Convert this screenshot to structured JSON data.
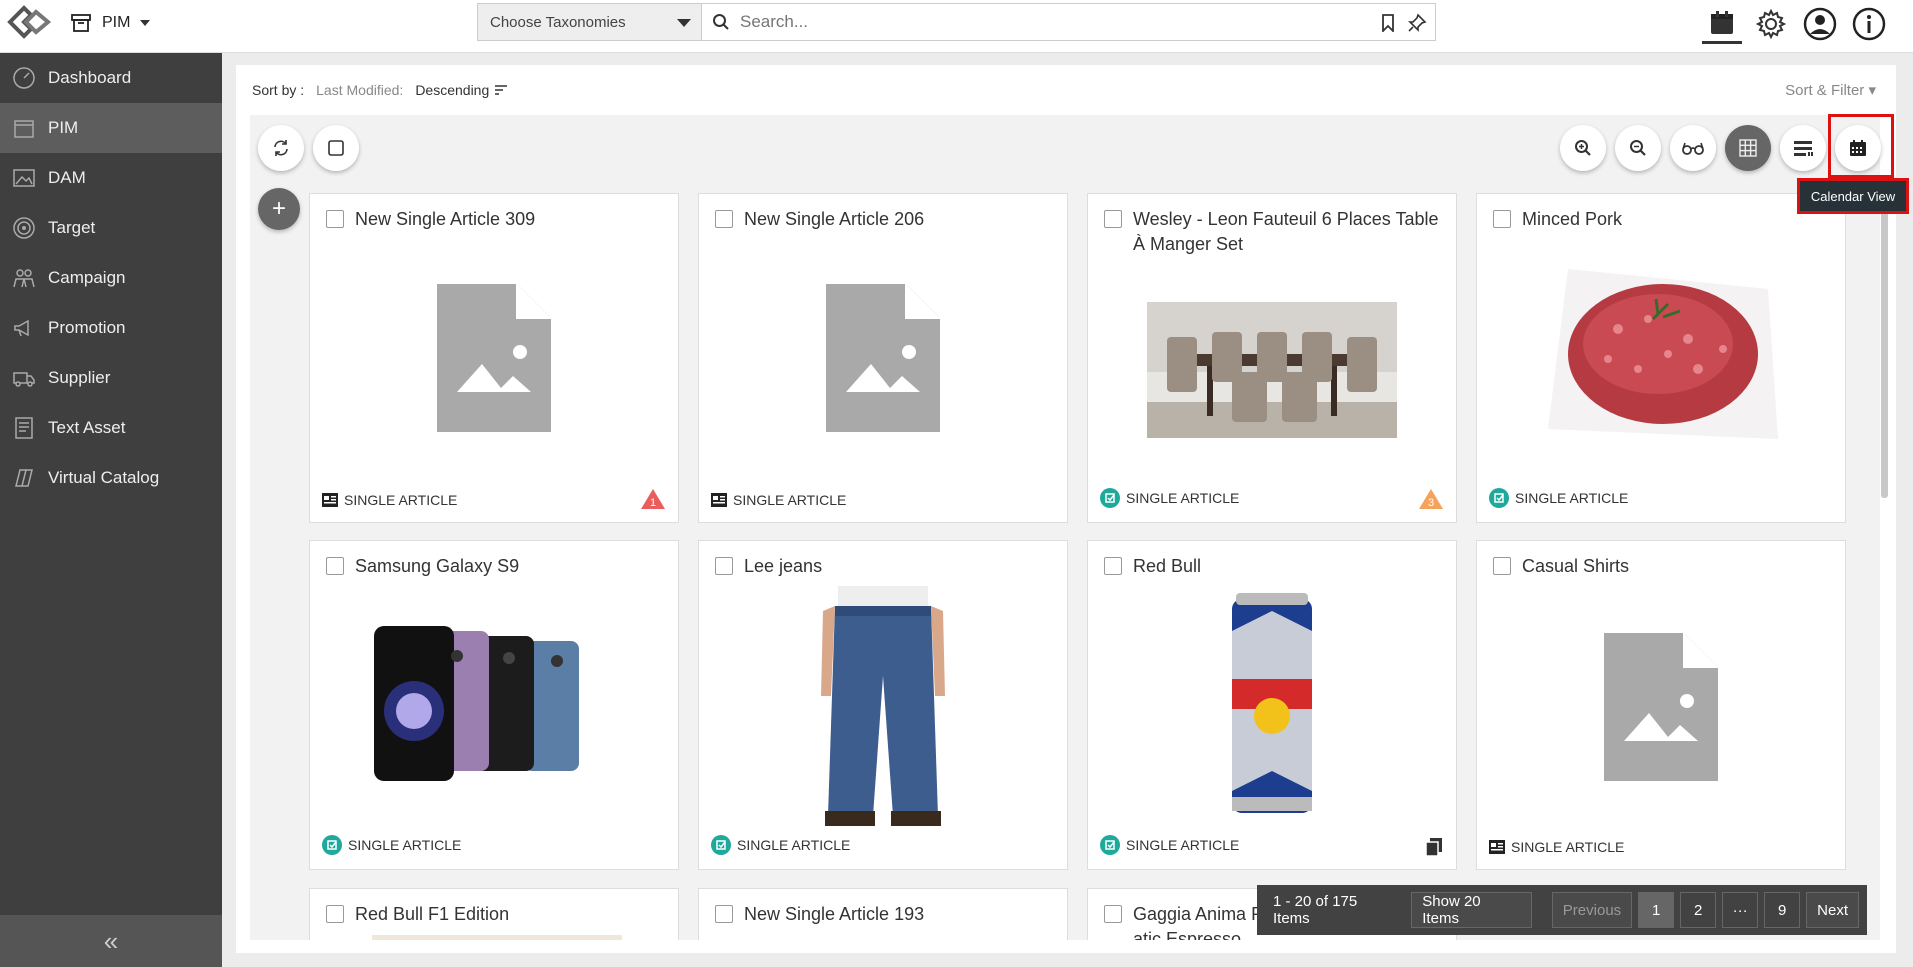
{
  "header": {
    "module": "PIM",
    "taxonomy_placeholder": "Choose Taxonomies",
    "search_placeholder": "Search..."
  },
  "sidebar": {
    "items": [
      {
        "label": "Dashboard",
        "icon": "dashboard-icon"
      },
      {
        "label": "PIM",
        "icon": "pim-icon"
      },
      {
        "label": "DAM",
        "icon": "image-icon"
      },
      {
        "label": "Target",
        "icon": "target-icon"
      },
      {
        "label": "Campaign",
        "icon": "campaign-icon"
      },
      {
        "label": "Promotion",
        "icon": "megaphone-icon"
      },
      {
        "label": "Supplier",
        "icon": "truck-icon"
      },
      {
        "label": "Text Asset",
        "icon": "text-asset-icon"
      },
      {
        "label": "Virtual Catalog",
        "icon": "catalog-icon"
      }
    ],
    "active": "PIM"
  },
  "sortbar": {
    "sort_by_label": "Sort by :",
    "last_modified_label": "Last Modified:",
    "direction": "Descending",
    "sort_filter": "Sort & Filter"
  },
  "tooltip": "Calendar View",
  "cards": [
    {
      "title": "New Single Article 309",
      "type": "SINGLE ARTICLE",
      "image": "placeholder",
      "badge": "1"
    },
    {
      "title": "New Single Article 206",
      "type": "SINGLE ARTICLE",
      "image": "placeholder",
      "badge": ""
    },
    {
      "title": "Wesley - Leon Fauteuil 6 Places Table À Manger Set",
      "type": "SINGLE ARTICLE",
      "image": "dining-table",
      "badge": "3"
    },
    {
      "title": "Minced Pork",
      "type": "SINGLE ARTICLE",
      "image": "minced-pork",
      "badge": ""
    },
    {
      "title": "Samsung Galaxy S9",
      "type": "SINGLE ARTICLE",
      "image": "phones",
      "badge": ""
    },
    {
      "title": "Lee jeans",
      "type": "SINGLE ARTICLE",
      "image": "jeans",
      "badge": ""
    },
    {
      "title": "Red Bull",
      "type": "SINGLE ARTICLE",
      "image": "can",
      "badge": ""
    },
    {
      "title": "Casual Shirts",
      "type": "SINGLE ARTICLE",
      "image": "placeholder",
      "badge": ""
    },
    {
      "title": "Red Bull F1 Edition",
      "type": "",
      "image": "",
      "badge": ""
    },
    {
      "title": "New Single Article 193",
      "type": "",
      "image": "",
      "badge": ""
    },
    {
      "title": "Gaggia Anima P…atic Espresso Machine",
      "type": "",
      "image": "",
      "badge": ""
    }
  ],
  "pagination": {
    "range": "1 - 20 of 175 Items",
    "show": "Show 20 Items",
    "previous": "Previous",
    "pages": [
      "1",
      "2",
      "···",
      "9"
    ],
    "next": "Next"
  }
}
